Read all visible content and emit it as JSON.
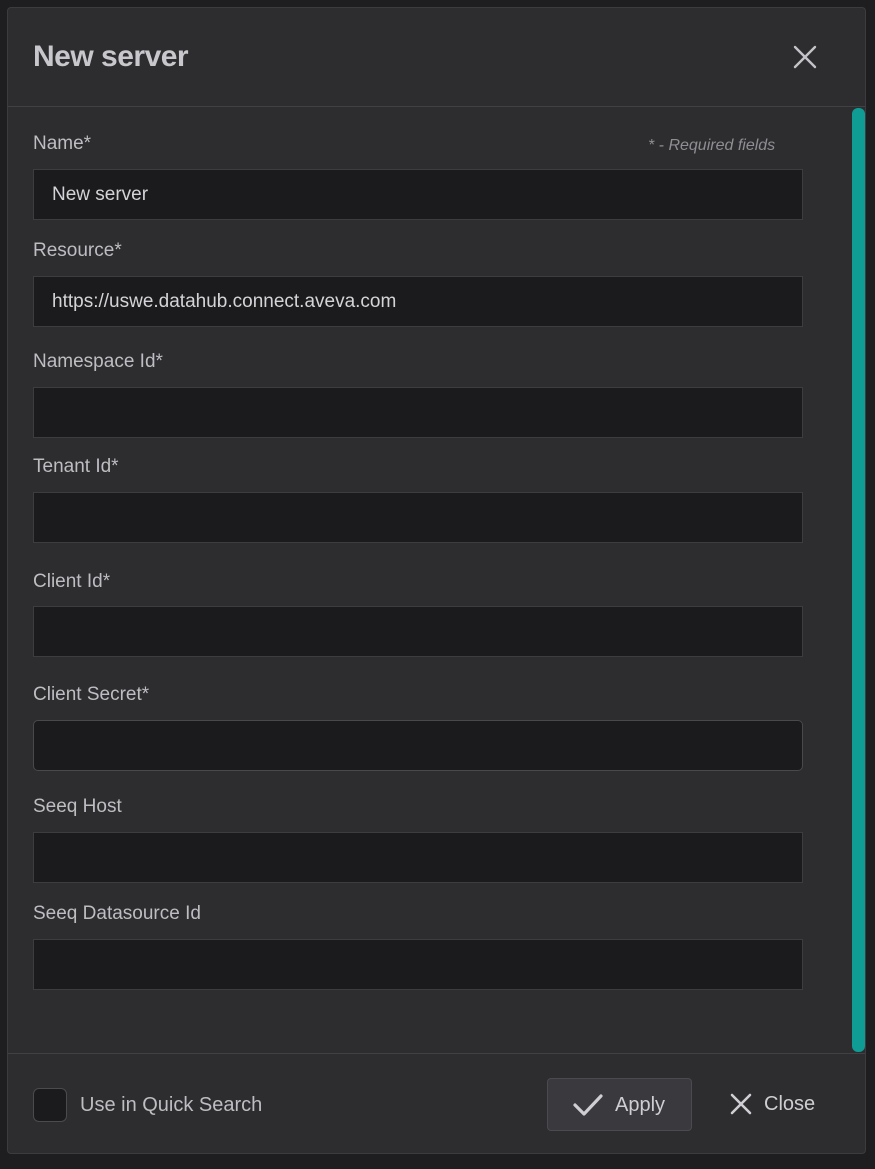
{
  "dialog": {
    "title": "New server",
    "close_icon": "close-icon"
  },
  "form": {
    "required_note": "* - Required fields",
    "fields": [
      {
        "label": "Name*",
        "value": "New server"
      },
      {
        "label": "Resource*",
        "value": "https://uswe.datahub.connect.aveva.com"
      },
      {
        "label": "Namespace Id*",
        "value": ""
      },
      {
        "label": "Tenant Id*",
        "value": ""
      },
      {
        "label": "Client Id*",
        "value": ""
      },
      {
        "label": "Client Secret*",
        "value": ""
      },
      {
        "label": "Seeq Host",
        "value": ""
      },
      {
        "label": "Seeq Datasource Id",
        "value": ""
      }
    ]
  },
  "footer": {
    "quick_search_label": "Use in Quick Search",
    "quick_search_checked": false,
    "apply_label": "Apply",
    "apply_icon": "check-icon",
    "close_label": "Close",
    "close_icon": "close-icon"
  },
  "colors": {
    "accent": "#0f9c94",
    "background": "#2d2d30",
    "input_background": "#1b1b1d"
  }
}
